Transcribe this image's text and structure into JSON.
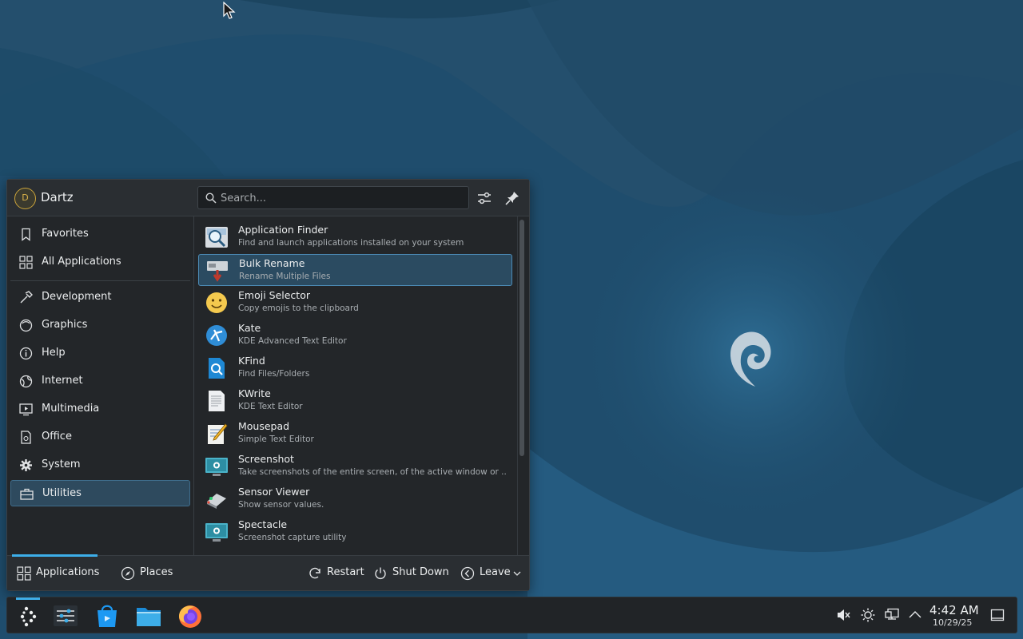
{
  "user": {
    "name": "Dartz",
    "initial": "D"
  },
  "search": {
    "placeholder": "Search...",
    "value": ""
  },
  "sidebar": {
    "items": [
      {
        "label": "Favorites",
        "icon": "bookmark-icon"
      },
      {
        "label": "All Applications",
        "icon": "grid-icon"
      },
      {
        "label": "Development",
        "icon": "hammer-icon"
      },
      {
        "label": "Graphics",
        "icon": "palette-icon"
      },
      {
        "label": "Help",
        "icon": "info-icon"
      },
      {
        "label": "Internet",
        "icon": "globe-icon"
      },
      {
        "label": "Multimedia",
        "icon": "play-screen-icon"
      },
      {
        "label": "Office",
        "icon": "document-icon"
      },
      {
        "label": "System",
        "icon": "gear-icon"
      },
      {
        "label": "Utilities",
        "icon": "toolbox-icon",
        "selected": true
      }
    ]
  },
  "apps": [
    {
      "name": "Application Finder",
      "description": "Find and launch applications installed on your system",
      "icon": "app-finder-icon"
    },
    {
      "name": "Bulk Rename",
      "description": "Rename Multiple Files",
      "icon": "bulk-rename-icon",
      "selected": true
    },
    {
      "name": "Emoji Selector",
      "description": "Copy emojis to the clipboard",
      "icon": "emoji-icon"
    },
    {
      "name": "Kate",
      "description": "KDE Advanced Text Editor",
      "icon": "kate-icon"
    },
    {
      "name": "KFind",
      "description": "Find Files/Folders",
      "icon": "kfind-icon"
    },
    {
      "name": "KWrite",
      "description": "KDE Text Editor",
      "icon": "kwrite-icon"
    },
    {
      "name": "Mousepad",
      "description": "Simple Text Editor",
      "icon": "mousepad-icon"
    },
    {
      "name": "Screenshot",
      "description": "Take screenshots of the entire screen, of the active window or ...",
      "icon": "screenshot-icon"
    },
    {
      "name": "Sensor Viewer",
      "description": "Show sensor values.",
      "icon": "sensor-viewer-icon"
    },
    {
      "name": "Spectacle",
      "description": "Screenshot capture utility",
      "icon": "spectacle-icon"
    }
  ],
  "footer": {
    "applications": "Applications",
    "places": "Places",
    "restart": "Restart",
    "shutdown": "Shut Down",
    "leave": "Leave"
  },
  "taskbar": {
    "items": [
      "app-launcher-icon",
      "system-settings-icon",
      "discover-store-icon",
      "file-manager-icon",
      "firefox-icon"
    ],
    "tray": [
      "volume-muted-icon",
      "brightness-icon",
      "network-icon",
      "chevron-up-icon"
    ],
    "clock": {
      "time": "4:42 AM",
      "date": "10/29/25"
    }
  },
  "colors": {
    "accent": "#3daee9",
    "panel": "#232629",
    "wallpaper": "#1f4c6b"
  }
}
